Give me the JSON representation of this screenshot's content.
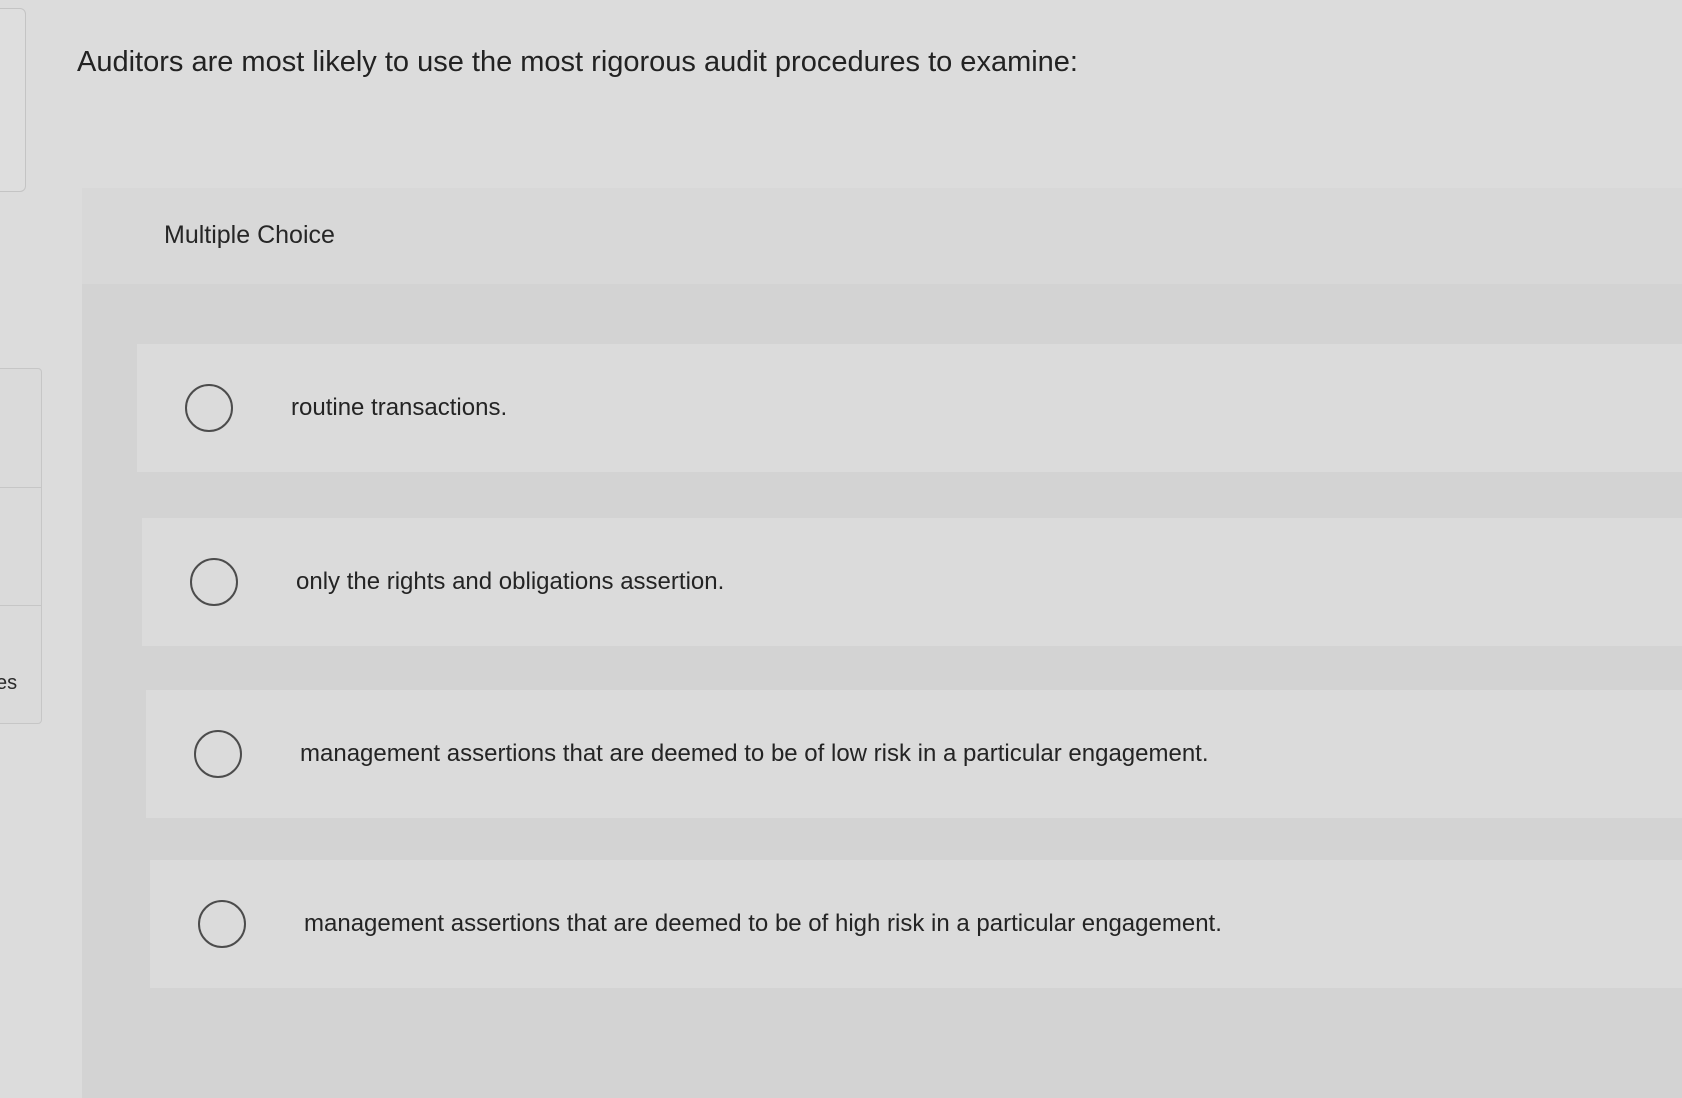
{
  "question": {
    "text": "Auditors are most likely to use the most rigorous audit procedures to examine:"
  },
  "panel": {
    "header_label": "Multiple Choice"
  },
  "choices": [
    {
      "label": "routine transactions."
    },
    {
      "label": "only the rights and obligations assertion."
    },
    {
      "label": "management assertions that are deemed to be of low risk in a particular engagement."
    },
    {
      "label": "management assertions that are deemed to be of high risk in a particular engagement."
    }
  ],
  "left_nav": {
    "label": "es"
  }
}
